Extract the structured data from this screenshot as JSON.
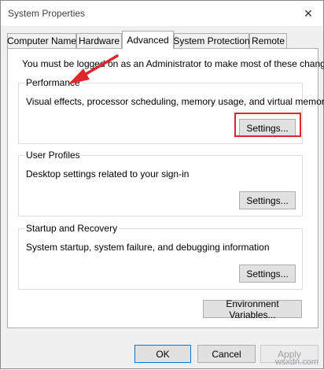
{
  "window": {
    "title": "System Properties",
    "close_glyph": "✕"
  },
  "tabs": [
    {
      "label": "Computer Name",
      "active": false
    },
    {
      "label": "Hardware",
      "active": false
    },
    {
      "label": "Advanced",
      "active": true
    },
    {
      "label": "System Protection",
      "active": false
    },
    {
      "label": "Remote",
      "active": false
    }
  ],
  "advanced": {
    "admin_note": "You must be logged on as an Administrator to make most of these changes.",
    "performance": {
      "label": "Performance",
      "description": "Visual effects, processor scheduling, memory usage, and virtual memory",
      "button": "Settings..."
    },
    "user_profiles": {
      "label": "User Profiles",
      "description": "Desktop settings related to your sign-in",
      "button": "Settings..."
    },
    "startup_recovery": {
      "label": "Startup and Recovery",
      "description": "System startup, system failure, and debugging information",
      "button": "Settings..."
    },
    "env_button": "Environment Variables..."
  },
  "footer": {
    "ok": "OK",
    "cancel": "Cancel",
    "apply": "Apply"
  },
  "watermark": "wsxdn.com",
  "colors": {
    "highlight": "#e0252b",
    "accent": "#0078d7"
  }
}
